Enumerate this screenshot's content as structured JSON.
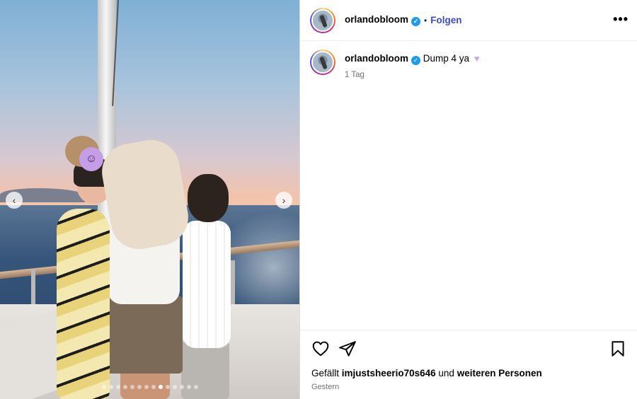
{
  "post": {
    "username": "orlandobloom",
    "verified": true,
    "follow_label": "Folgen",
    "separator": "•",
    "more_label": "•••"
  },
  "caption": {
    "username": "orlandobloom",
    "text": "Dump 4 ya",
    "emoji": "♥",
    "time": "1 Tag"
  },
  "carousel": {
    "prev_label": "‹",
    "next_label": "›",
    "dot_count": 14,
    "active_index": 8,
    "face_cover_emoji": "☺"
  },
  "footer": {
    "likes_prefix": "Gefällt",
    "likes_user": "imjustsheerio70s646",
    "likes_middle": "und",
    "likes_suffix": "weiteren Personen",
    "date": "Gestern"
  },
  "icons": {
    "like": "heart-outline-icon",
    "share": "paper-plane-icon",
    "save": "bookmark-icon",
    "verified": "verified-badge-icon"
  },
  "colors": {
    "follow": "#3b4bd8",
    "verified": "#1d9bf0",
    "muted": "#737373"
  }
}
